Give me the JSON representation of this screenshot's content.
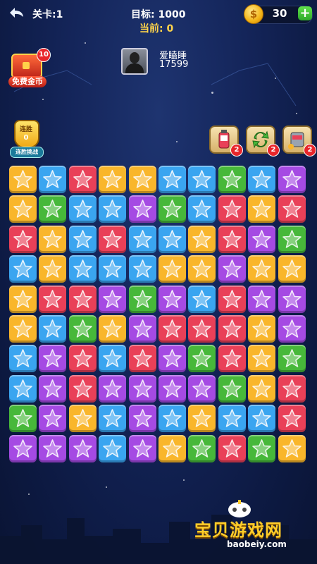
{
  "header": {
    "level_label": "关卡:1",
    "target_label": "目标: 1000",
    "current_label": "当前: 0",
    "coins": "30",
    "coin_symbol": "$",
    "add_symbol": "+"
  },
  "player": {
    "name": "爱瞌睡",
    "score": "17599"
  },
  "chest": {
    "badge": "10",
    "label": "免费金币"
  },
  "streak": {
    "top": "连胜",
    "count": "0",
    "label": "连胜挑战"
  },
  "tools": [
    {
      "icon": "hammer-bottle-icon",
      "count": "2"
    },
    {
      "icon": "refresh-icon",
      "count": "2"
    },
    {
      "icon": "paint-bucket-icon",
      "count": "2"
    }
  ],
  "colors": {
    "Y": "#f9b62b",
    "B": "#3aa5f0",
    "R": "#e94058",
    "G": "#47b83a",
    "P": "#a54ae3"
  },
  "board": [
    "YBRYYBBGBP",
    "YGBBPGBRYR",
    "RYBRBBYRPG",
    "BYBBBYYPYY",
    "YRRPGPBRPP",
    "YBGYPRRRYP",
    "BPRBRPGRYG",
    "BPRPPPPGYR",
    "GPYBPBYBBR",
    "PPPBPYGRGY"
  ],
  "watermark": {
    "text": "宝贝游戏网",
    "url": "baobeiy.com"
  }
}
